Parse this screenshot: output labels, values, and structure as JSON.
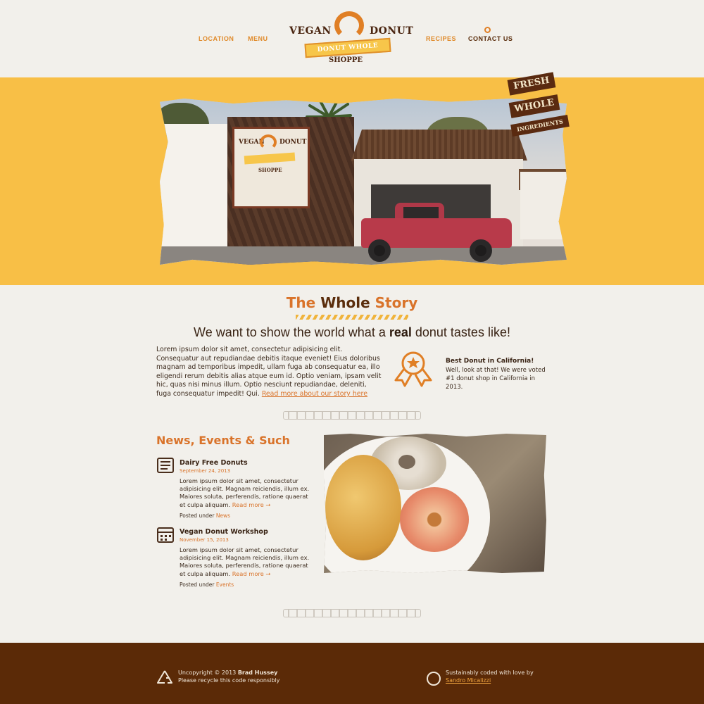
{
  "nav": {
    "location": "LOCATION",
    "menu": "MENU",
    "recipes": "RECIPES",
    "contact": "CONTACT US"
  },
  "logo": {
    "word_left": "VEGAN",
    "word_right": "DONUT",
    "ribbon": "DONUT WHOLE",
    "sub": "SHOPPE"
  },
  "hero": {
    "badge_line1": "FRESH",
    "badge_line2": "WHOLE",
    "badge_line3": "INGREDIENTS"
  },
  "story": {
    "title_part1": "The ",
    "title_part2": "Whole",
    "title_part3": " Story",
    "tagline_pre": "We want to show the world what a ",
    "tagline_bold": "real",
    "tagline_post": " donut tastes like!",
    "body": "Lorem ipsum dolor sit amet, consectetur adipisicing elit. Consequatur aut repudiandae debitis itaque eveniet! Eius doloribus magnam ad temporibus impedit, ullam fuga ab consequatur ea, illo eligendi rerum debitis alias atque eum id. Optio veniam, ipsam velit hic, quas nisi minus illum. Optio nesciunt repudiandae, deleniti, fuga consequatur impedit! Qui. ",
    "read_more": "Read more about our story here",
    "award_title": "Best Donut in California!",
    "award_text": "Well, look at that! We were voted #1 donut shop in California in 2013."
  },
  "news": {
    "heading": "News, Events & Such",
    "items": [
      {
        "title": "Dairy Free Donuts",
        "date": "September 24, 2013",
        "text": "Lorem ipsum dolor sit amet, consectetur adipisicing elit. Magnam reiciendis, illum ex. Maiores soluta, perferendis, ratione quaerat et culpa aliquam. ",
        "more": "Read more →",
        "posted_label": "Posted under ",
        "category": "News"
      },
      {
        "title": "Vegan Donut Workshop",
        "date": "November 15, 2013",
        "text": "Lorem ipsum dolor sit amet, consectetur adipisicing elit. Magnam reiciendis, illum ex. Maiores soluta, perferendis, ratione quaerat et culpa aliquam. ",
        "more": "Read more →",
        "posted_label": "Posted under ",
        "category": "Events"
      }
    ]
  },
  "footer": {
    "copyright_pre": "Uncopyright © 2013 ",
    "copyright_name": "Brad Hussey",
    "recycle": "Please recycle this code responsibly",
    "coded": "Sustainably coded with love by",
    "coder": "Sandro Micalizzi"
  },
  "colors": {
    "accent": "#e07f25",
    "hero_band": "#f8bf46",
    "footer": "#5b2a07",
    "background": "#f2f0eb"
  }
}
